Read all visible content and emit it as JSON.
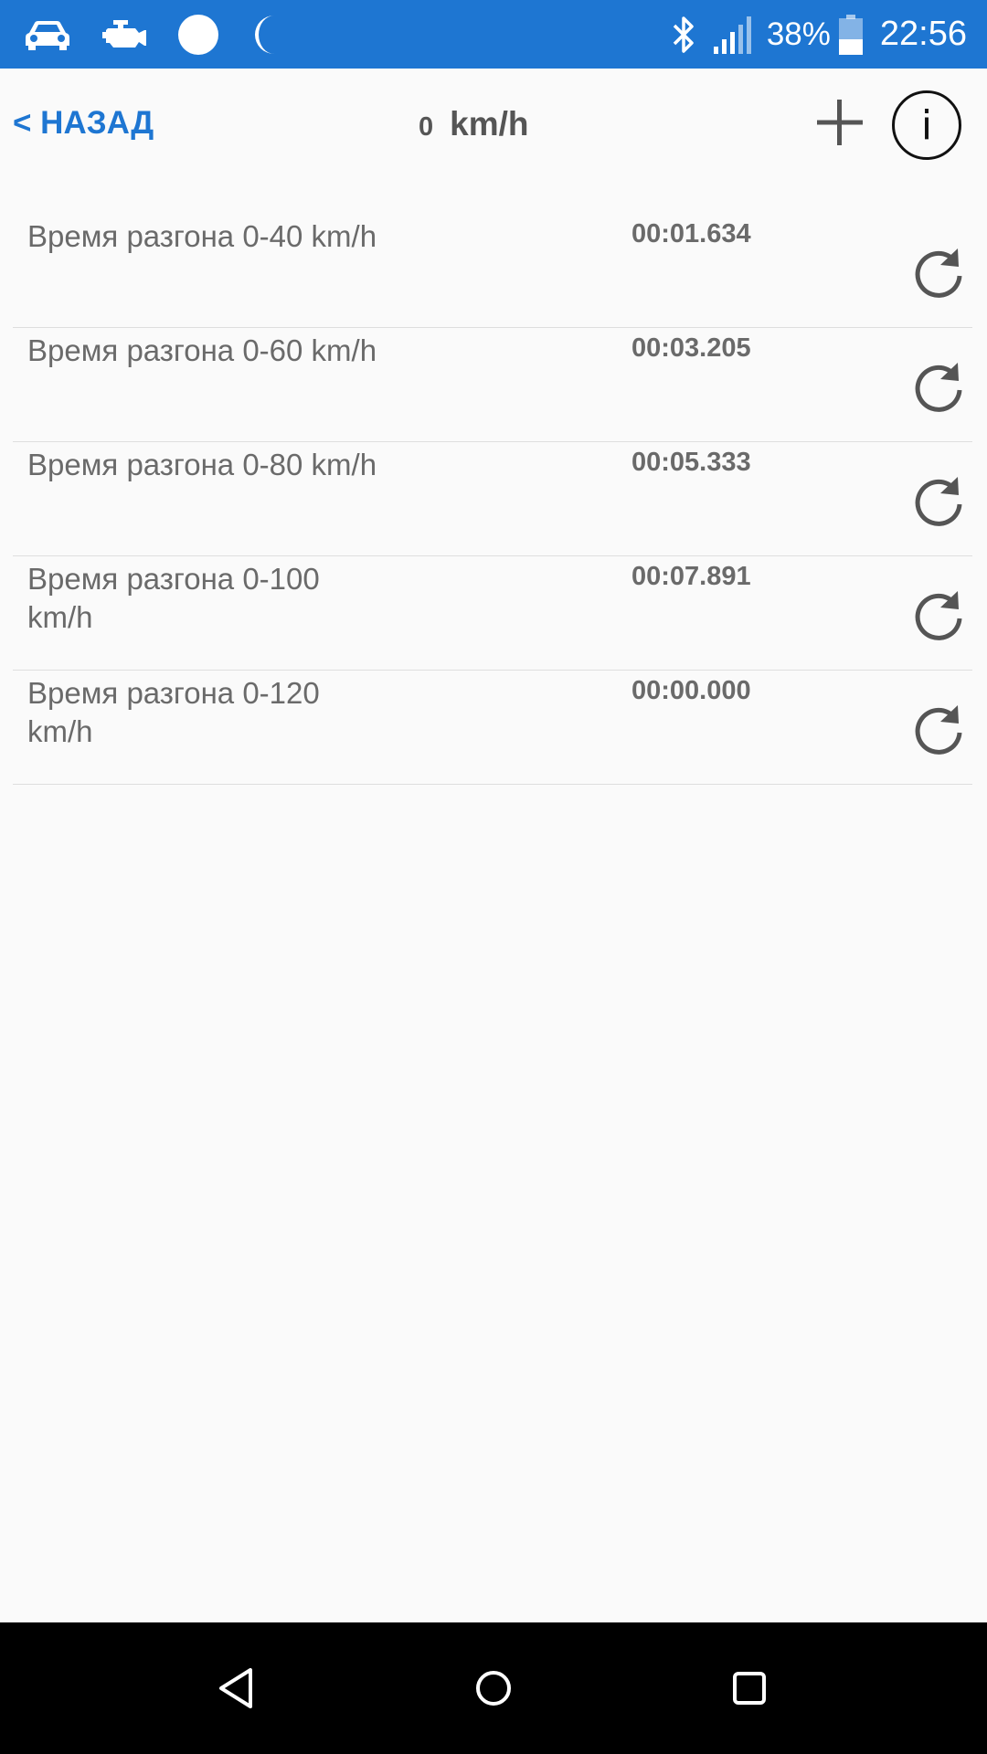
{
  "status_bar": {
    "left_icons": [
      "car-icon",
      "engine-icon",
      "circle-icon",
      "moon-icon"
    ],
    "right_icons": [
      "bluetooth-icon",
      "signal-icon",
      "battery-icon"
    ],
    "battery": "38%",
    "time": "22:56",
    "color": "#1e76d2"
  },
  "header": {
    "back_label": "< НАЗАД",
    "speed_value": "0",
    "speed_unit": "km/h",
    "add_icon": "plus-icon",
    "info_icon": "info-icon"
  },
  "results": [
    {
      "label": "Время разгона  0-40 km/h",
      "time": "00:01.634"
    },
    {
      "label": "Время разгона  0-60 km/h",
      "time": "00:03.205"
    },
    {
      "label": "Время разгона  0-80 km/h",
      "time": "00:05.333"
    },
    {
      "label": "Время разгона  0-100 km/h",
      "time": "00:07.891"
    },
    {
      "label": "Время разгона  0-120 km/h",
      "time": "00:00.000"
    }
  ],
  "nav_bar": {
    "icons": [
      "back-triangle-icon",
      "home-circle-icon",
      "recents-square-icon"
    ]
  }
}
